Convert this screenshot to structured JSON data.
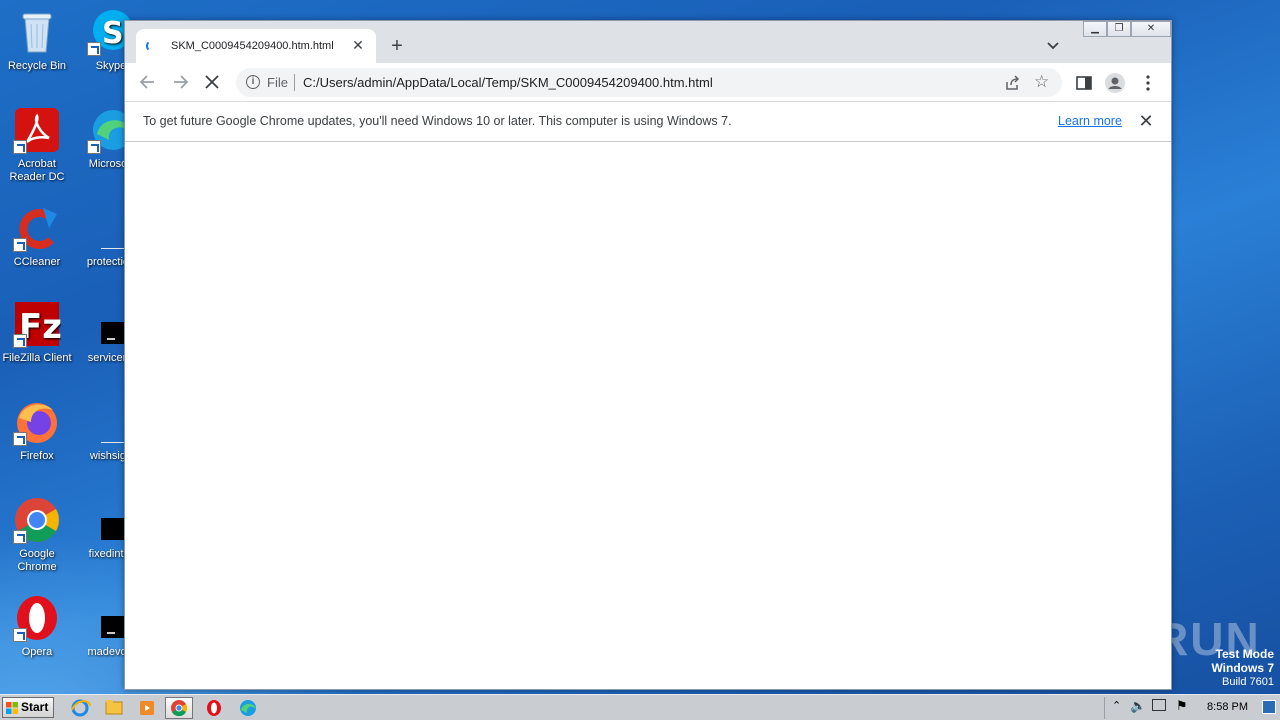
{
  "desktop": {
    "icons_col1": [
      {
        "name": "recycle-bin-icon",
        "label": "Recycle Bin"
      },
      {
        "name": "acrobat-reader-icon",
        "label": "Acrobat Reader DC"
      },
      {
        "name": "ccleaner-icon",
        "label": "CCleaner"
      },
      {
        "name": "filezilla-icon",
        "label": "FileZilla Client"
      },
      {
        "name": "firefox-icon",
        "label": "Firefox"
      },
      {
        "name": "google-chrome-icon",
        "label": "Google Chrome"
      },
      {
        "name": "opera-icon",
        "label": "Opera"
      }
    ],
    "icons_col2": [
      {
        "name": "skype-icon",
        "label": "Skype"
      },
      {
        "name": "microsoft-edge-icon",
        "label": "Microsoft"
      },
      {
        "name": "file-icon",
        "label": "protection"
      },
      {
        "name": "console-file-icon",
        "label": "servicemi"
      },
      {
        "name": "file-icon",
        "label": "wishsign"
      },
      {
        "name": "console-file-icon",
        "label": "fixedinter"
      },
      {
        "name": "console-file-icon",
        "label": "madevoic"
      }
    ]
  },
  "browser": {
    "tab_title": "SKM_C0009454209400.htm.html",
    "omnibox": {
      "scheme": "File",
      "url": "C:/Users/admin/AppData/Local/Temp/SKM_C0009454209400.htm.html"
    },
    "infobar": {
      "message": "To get future Google Chrome updates, you'll need Windows 10 or later. This computer is using Windows 7.",
      "link": "Learn more"
    }
  },
  "watermark": {
    "text": "ANY RUN",
    "mode": "Test Mode",
    "os": "Windows 7",
    "build": "Build 7601"
  },
  "taskbar": {
    "start_label": "Start",
    "clock": "8:58 PM"
  },
  "colors": {
    "desktop": "#1e6fc7",
    "accent": "#1a73e8",
    "tabbar": "#dee1e6"
  }
}
